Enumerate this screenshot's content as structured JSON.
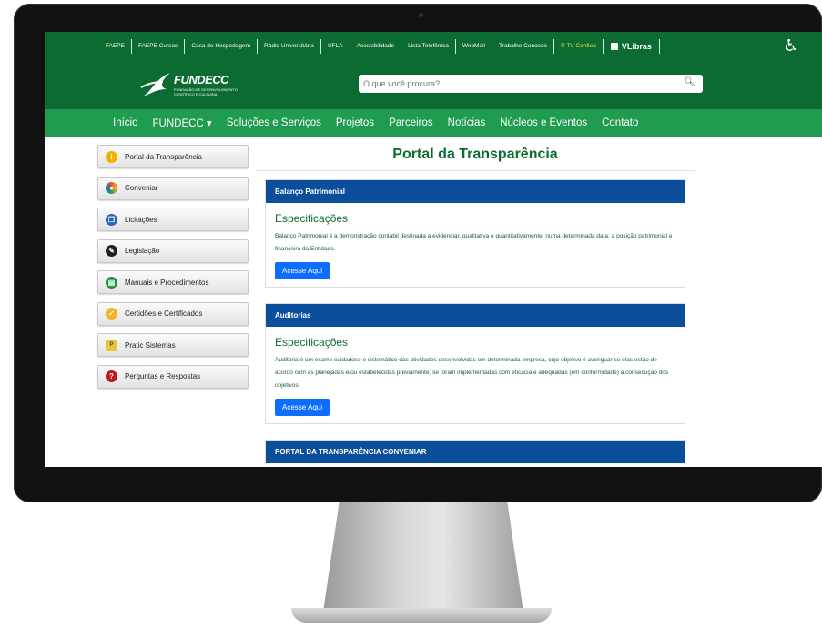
{
  "top_links": [
    "FAEPE",
    "FAEPE Cursos",
    "Casa de Hospedagem",
    "Rádio Universitária",
    "UFLA",
    "Acessibilidade",
    "Lista Telefônica",
    "WebMail",
    "Trabalhe Conosco",
    "® TV Confiea"
  ],
  "vlibras_label": "VLibras",
  "brand": {
    "name": "FUNDECC",
    "tagline": "FUNDAÇÃO DE DESENVOLVIMENTO CIENTÍFICO E CULTURAL"
  },
  "search": {
    "placeholder": "O que você procura?"
  },
  "nav": [
    "Início",
    "FUNDECC ▾",
    "Soluções e Serviços",
    "Projetos",
    "Parceiros",
    "Notícias",
    "Núcleos e Eventos",
    "Contato"
  ],
  "sidebar": [
    {
      "label": "Portal da Transparência",
      "icon": "info-icon",
      "color": "#f0b400",
      "glyph": "i"
    },
    {
      "label": "Conveniar",
      "icon": "conveniar-icon",
      "color": "#e9572b",
      "glyph": "◉"
    },
    {
      "label": "Licitações",
      "icon": "licitacoes-icon",
      "color": "#2a63b7",
      "glyph": "❐"
    },
    {
      "label": "Legislação",
      "icon": "legislacao-icon",
      "color": "#222222",
      "glyph": "✎"
    },
    {
      "label": "Manuais e Procedimentos",
      "icon": "book-icon",
      "color": "#1b8f3b",
      "glyph": "▤"
    },
    {
      "label": "Certidões e Certificados",
      "icon": "certificate-icon",
      "color": "#f2b526",
      "glyph": "✓"
    },
    {
      "label": "Pratic Sistemas",
      "icon": "pratic-icon",
      "color": "#e7c43a",
      "glyph": "P"
    },
    {
      "label": "Perguntas e Respostas",
      "icon": "question-icon",
      "color": "#c0171c",
      "glyph": "?"
    }
  ],
  "main": {
    "title": "Portal da Transparência",
    "cards": [
      {
        "heading": "Balanço Patrimonial",
        "sub": "Especificações",
        "text": "Balanço Patrimonial é a demonstração contábil destinada a evidenciar, qualitativa e quantitativamente, numa determinada data, a posição patrimonial e financeira da Entidade.",
        "button": "Acesse Aqui"
      },
      {
        "heading": "Auditorias",
        "sub": "Especificações",
        "text": "Auditoria é um exame cuidadoso e sistemático das atividades desenvolvidas em determinada empresa, cujo objetivo é averiguar se elas estão de acordo com as planejadas e/ou estabelecidas previamente, se foram implementadas com eficácia e adequadas (em conformidade) à consecução dos objetivos.",
        "button": "Acesse Aqui"
      },
      {
        "heading": "PORTAL DA TRANSPARÊNCIA CONVENIAR"
      }
    ]
  }
}
